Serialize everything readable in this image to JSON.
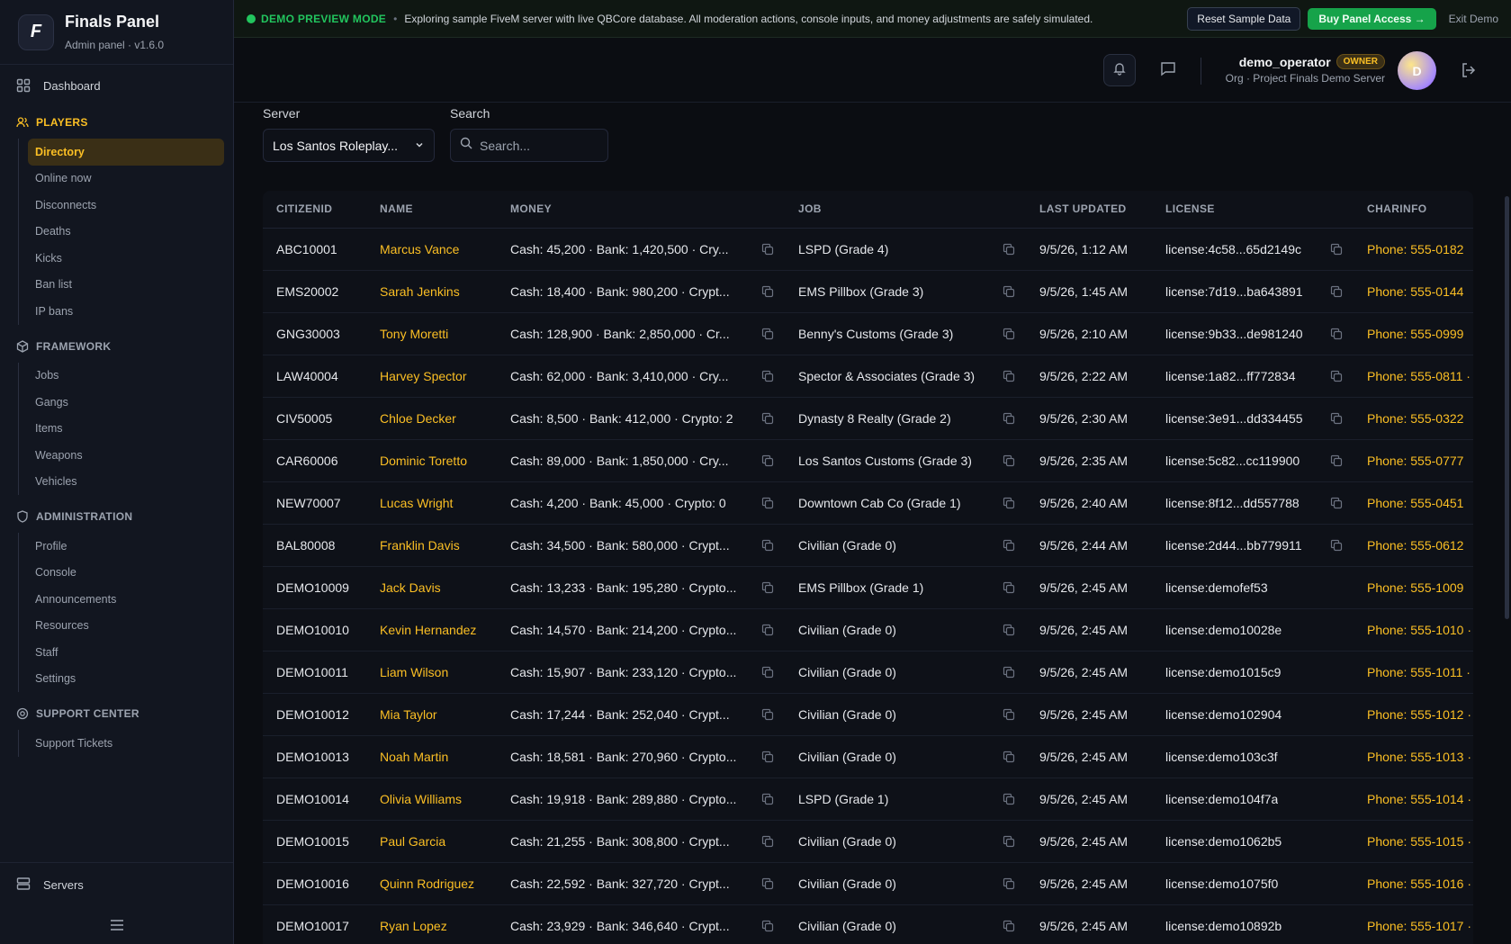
{
  "brand": {
    "title": "Finals Panel",
    "subtitle": "Admin panel · v1.6.0",
    "logo_letter": "F"
  },
  "sidebar": {
    "dashboard": "Dashboard",
    "sections": [
      {
        "title": "PLAYERS",
        "icon": "users-icon",
        "items": [
          "Directory",
          "Online now",
          "Disconnects",
          "Deaths",
          "Kicks",
          "Ban list",
          "IP bans"
        ]
      },
      {
        "title": "FRAMEWORK",
        "icon": "cube-icon",
        "items": [
          "Jobs",
          "Gangs",
          "Items",
          "Weapons",
          "Vehicles"
        ]
      },
      {
        "title": "ADMINISTRATION",
        "icon": "shield-icon",
        "items": [
          "Profile",
          "Console",
          "Announcements",
          "Resources",
          "Staff",
          "Settings"
        ]
      },
      {
        "title": "SUPPORT CENTER",
        "icon": "lifebuoy-icon",
        "items": [
          "Support Tickets"
        ]
      }
    ],
    "active_item": "Directory",
    "servers": "Servers"
  },
  "banner": {
    "mode": "DEMO PREVIEW MODE",
    "message": "Exploring sample FiveM server with live QBCore database. All moderation actions, console inputs, and money adjustments are safely simulated.",
    "reset_label": "Reset Sample Data",
    "buy_label": "Buy Panel Access →",
    "exit_label": "Exit Demo"
  },
  "header": {
    "user_name": "demo_operator",
    "role_badge": "OWNER",
    "org": "Org · Project Finals Demo Server",
    "avatar_letter": "D"
  },
  "filters": {
    "server_label": "Server",
    "server_value": "Los Santos Roleplay...",
    "search_label": "Search",
    "search_placeholder": "Search..."
  },
  "table": {
    "columns": [
      "CITIZENID",
      "NAME",
      "MONEY",
      "JOB",
      "LAST UPDATED",
      "LICENSE",
      "CHARINFO"
    ],
    "rows": [
      {
        "citizenid": "ABC10001",
        "name": "Marcus Vance",
        "money": "Cash: 45,200 · Bank: 1,420,500 · Cry...",
        "job": "LSPD (Grade 4)",
        "updated": "9/5/26, 1:12 AM",
        "license": "license:4c58...65d2149c",
        "license_copy": true,
        "charinfo": "Phone: 555-0182"
      },
      {
        "citizenid": "EMS20002",
        "name": "Sarah Jenkins",
        "money": "Cash: 18,400 · Bank: 980,200 · Crypt...",
        "job": "EMS Pillbox (Grade 3)",
        "updated": "9/5/26, 1:45 AM",
        "license": "license:7d19...ba643891",
        "license_copy": true,
        "charinfo": "Phone: 555-0144"
      },
      {
        "citizenid": "GNG30003",
        "name": "Tony Moretti",
        "money": "Cash: 128,900 · Bank: 2,850,000 · Cr...",
        "job": "Benny's Customs (Grade 3)",
        "updated": "9/5/26, 2:10 AM",
        "license": "license:9b33...de981240",
        "license_copy": true,
        "charinfo": "Phone: 555-0999"
      },
      {
        "citizenid": "LAW40004",
        "name": "Harvey Spector",
        "money": "Cash: 62,000 · Bank: 3,410,000 · Cry...",
        "job": "Spector & Associates (Grade 3)",
        "updated": "9/5/26, 2:22 AM",
        "license": "license:1a82...ff772834",
        "license_copy": true,
        "charinfo": "Phone: 555-0811 ·"
      },
      {
        "citizenid": "CIV50005",
        "name": "Chloe Decker",
        "money": "Cash: 8,500 · Bank: 412,000 · Crypto: 2",
        "job": "Dynasty 8 Realty (Grade 2)",
        "updated": "9/5/26, 2:30 AM",
        "license": "license:3e91...dd334455",
        "license_copy": true,
        "charinfo": "Phone: 555-0322"
      },
      {
        "citizenid": "CAR60006",
        "name": "Dominic Toretto",
        "money": "Cash: 89,000 · Bank: 1,850,000 · Cry...",
        "job": "Los Santos Customs (Grade 3)",
        "updated": "9/5/26, 2:35 AM",
        "license": "license:5c82...cc119900",
        "license_copy": true,
        "charinfo": "Phone: 555-0777"
      },
      {
        "citizenid": "NEW70007",
        "name": "Lucas Wright",
        "money": "Cash: 4,200 · Bank: 45,000 · Crypto: 0",
        "job": "Downtown Cab Co (Grade 1)",
        "updated": "9/5/26, 2:40 AM",
        "license": "license:8f12...dd557788",
        "license_copy": true,
        "charinfo": "Phone: 555-0451"
      },
      {
        "citizenid": "BAL80008",
        "name": "Franklin Davis",
        "money": "Cash: 34,500 · Bank: 580,000 · Crypt...",
        "job": "Civilian (Grade 0)",
        "updated": "9/5/26, 2:44 AM",
        "license": "license:2d44...bb779911",
        "license_copy": true,
        "charinfo": "Phone: 555-0612"
      },
      {
        "citizenid": "DEMO10009",
        "name": "Jack Davis",
        "money": "Cash: 13,233 · Bank: 195,280 · Crypto...",
        "job": "EMS Pillbox (Grade 1)",
        "updated": "9/5/26, 2:45 AM",
        "license": "license:demofef53",
        "license_copy": false,
        "charinfo": "Phone: 555-1009"
      },
      {
        "citizenid": "DEMO10010",
        "name": "Kevin Hernandez",
        "money": "Cash: 14,570 · Bank: 214,200 · Crypto...",
        "job": "Civilian (Grade 0)",
        "updated": "9/5/26, 2:45 AM",
        "license": "license:demo10028e",
        "license_copy": false,
        "charinfo": "Phone: 555-1010 ·"
      },
      {
        "citizenid": "DEMO10011",
        "name": "Liam Wilson",
        "money": "Cash: 15,907 · Bank: 233,120 · Crypto...",
        "job": "Civilian (Grade 0)",
        "updated": "9/5/26, 2:45 AM",
        "license": "license:demo1015c9",
        "license_copy": false,
        "charinfo": "Phone: 555-1011 ·"
      },
      {
        "citizenid": "DEMO10012",
        "name": "Mia Taylor",
        "money": "Cash: 17,244 · Bank: 252,040 · Crypt...",
        "job": "Civilian (Grade 0)",
        "updated": "9/5/26, 2:45 AM",
        "license": "license:demo102904",
        "license_copy": false,
        "charinfo": "Phone: 555-1012 ·"
      },
      {
        "citizenid": "DEMO10013",
        "name": "Noah Martin",
        "money": "Cash: 18,581 · Bank: 270,960 · Crypto...",
        "job": "Civilian (Grade 0)",
        "updated": "9/5/26, 2:45 AM",
        "license": "license:demo103c3f",
        "license_copy": false,
        "charinfo": "Phone: 555-1013 ·"
      },
      {
        "citizenid": "DEMO10014",
        "name": "Olivia Williams",
        "money": "Cash: 19,918 · Bank: 289,880 · Crypto...",
        "job": "LSPD (Grade 1)",
        "updated": "9/5/26, 2:45 AM",
        "license": "license:demo104f7a",
        "license_copy": false,
        "charinfo": "Phone: 555-1014 ·"
      },
      {
        "citizenid": "DEMO10015",
        "name": "Paul Garcia",
        "money": "Cash: 21,255 · Bank: 308,800 · Crypt...",
        "job": "Civilian (Grade 0)",
        "updated": "9/5/26, 2:45 AM",
        "license": "license:demo1062b5",
        "license_copy": false,
        "charinfo": "Phone: 555-1015 ·"
      },
      {
        "citizenid": "DEMO10016",
        "name": "Quinn Rodriguez",
        "money": "Cash: 22,592 · Bank: 327,720 · Crypt...",
        "job": "Civilian (Grade 0)",
        "updated": "9/5/26, 2:45 AM",
        "license": "license:demo1075f0",
        "license_copy": false,
        "charinfo": "Phone: 555-1016 ·"
      },
      {
        "citizenid": "DEMO10017",
        "name": "Ryan Lopez",
        "money": "Cash: 23,929 · Bank: 346,640 · Crypt...",
        "job": "Civilian (Grade 0)",
        "updated": "9/5/26, 2:45 AM",
        "license": "license:demo10892b",
        "license_copy": false,
        "charinfo": "Phone: 555-1017 ·"
      }
    ]
  },
  "colors": {
    "accent": "#fbbf24",
    "demo_green": "#22c55e",
    "buy_button": "#16a34a",
    "background": "#0b0d12",
    "sidebar": "#121620"
  }
}
